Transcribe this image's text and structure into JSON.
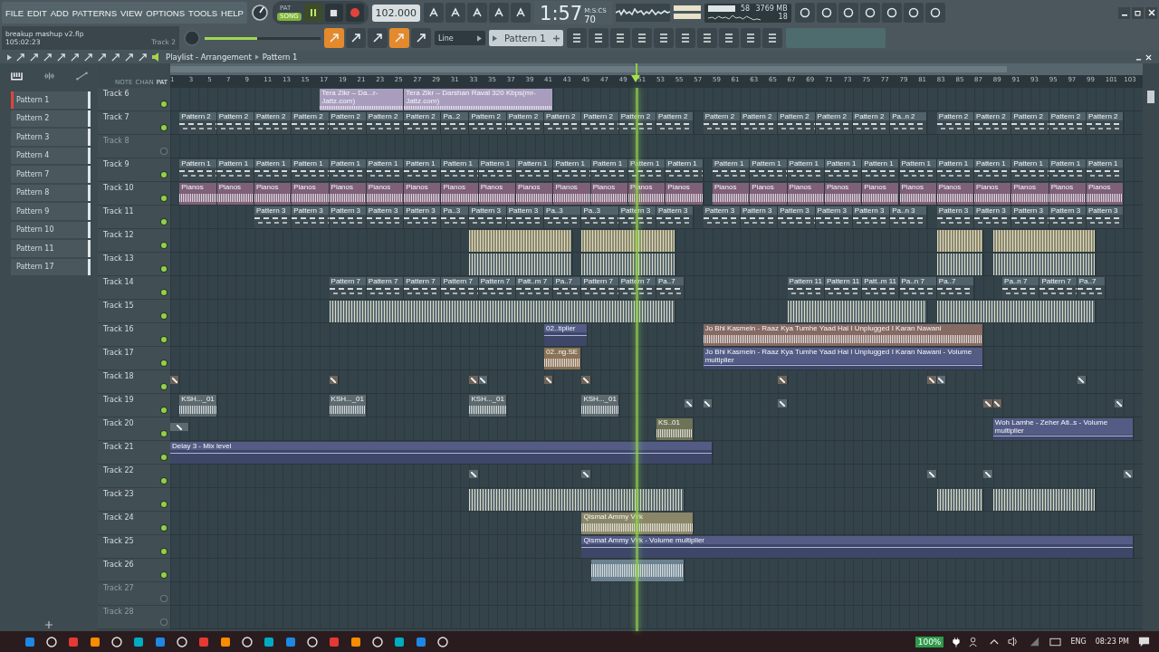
{
  "menu": [
    "FILE",
    "EDIT",
    "ADD",
    "PATTERNS",
    "VIEW",
    "OPTIONS",
    "TOOLS",
    "HELP"
  ],
  "transport": {
    "modes": [
      {
        "label": "PAT",
        "selected": false
      },
      {
        "label": "SONG",
        "selected": true
      }
    ],
    "playing": true,
    "tempo": "102.000",
    "time": "1:57",
    "time_sub": "70",
    "time_unit": "M:S:CS"
  },
  "monitor": {
    "cpu": "58",
    "memory": "3769 MB",
    "polyphony": "18"
  },
  "project": {
    "file": "breakup mashup v2.flp",
    "position": "105:02:23",
    "hint": "Track 2"
  },
  "master_volume": {
    "level": 0.45
  },
  "snap": "Line",
  "current_pattern": "Pattern 1",
  "playlist": {
    "title": "Playlist - Arrangement",
    "crumb": "Pattern 1",
    "picker_tabs": [
      {
        "label": "NOTE",
        "selected": false
      },
      {
        "label": "CHAN",
        "selected": false
      },
      {
        "label": "PAT",
        "selected": true
      }
    ],
    "patterns": [
      {
        "name": "Pattern 1",
        "selected": true
      },
      {
        "name": "Pattern 2",
        "selected": false
      },
      {
        "name": "Pattern 3",
        "selected": false
      },
      {
        "name": "Pattern 4",
        "selected": false
      },
      {
        "name": "Pattern 7",
        "selected": false
      },
      {
        "name": "Pattern 8",
        "selected": false
      },
      {
        "name": "Pattern 9",
        "selected": false
      },
      {
        "name": "Pattern 10",
        "selected": false
      },
      {
        "name": "Pattern 11",
        "selected": false
      },
      {
        "name": "Pattern 17",
        "selected": false
      }
    ],
    "ruler": [
      "1",
      "3",
      "5",
      "7",
      "9",
      "11",
      "13",
      "15",
      "17",
      "19",
      "21",
      "23",
      "25",
      "27",
      "29",
      "31",
      "33",
      "35",
      "37",
      "39",
      "41",
      "43",
      "45",
      "47",
      "49",
      "51",
      "53",
      "55",
      "57",
      "59",
      "61",
      "63",
      "65",
      "67",
      "69",
      "71",
      "73",
      "75",
      "77",
      "79",
      "81",
      "83",
      "85",
      "87",
      "89",
      "91",
      "93",
      "95",
      "97",
      "99",
      "101",
      "103"
    ],
    "tracks": [
      {
        "name": "Track 6",
        "muted": false,
        "clips": [
          {
            "kind": "audio",
            "label": "Tera Zikr – Da...r-Jattz.com)",
            "color": "#a99dbd"
          },
          {
            "kind": "audio",
            "label": "Tera Zikr – Darshan Raval 320 Kbps(mr-Jattz.com)",
            "color": "#a99dbd"
          }
        ]
      },
      {
        "name": "Track 7",
        "muted": false,
        "clips": [
          {
            "kind": "pattern",
            "label": "Pattern 2",
            "color": "#52626a"
          },
          {
            "kind": "pattern",
            "label": "Pattern 2",
            "color": "#52626a"
          },
          {
            "kind": "pattern",
            "label": "Pattern 2",
            "color": "#52626a"
          },
          {
            "kind": "pattern",
            "label": "Pattern 2",
            "color": "#52626a"
          },
          {
            "kind": "pattern",
            "label": "Pattern 2",
            "color": "#52626a"
          },
          {
            "kind": "pattern",
            "label": "Pattern 2",
            "color": "#52626a"
          },
          {
            "kind": "pattern",
            "label": "Pattern 2",
            "color": "#52626a"
          },
          {
            "kind": "pattern",
            "label": "Pa..2",
            "color": "#52626a"
          },
          {
            "kind": "pattern",
            "label": "Pattern 2",
            "color": "#52626a"
          },
          {
            "kind": "pattern",
            "label": "Pattern 2",
            "color": "#52626a"
          },
          {
            "kind": "pattern",
            "label": "Pattern 2",
            "color": "#52626a"
          },
          {
            "kind": "pattern",
            "label": "Pattern 2",
            "color": "#52626a"
          },
          {
            "kind": "pattern",
            "label": "Pattern 2",
            "color": "#52626a"
          },
          {
            "kind": "pattern",
            "label": "Pattern 2",
            "color": "#52626a"
          },
          {
            "kind": "pattern",
            "label": "Pattern 2",
            "color": "#52626a"
          },
          {
            "kind": "pattern",
            "label": "Pattern 2",
            "color": "#52626a"
          },
          {
            "kind": "pattern",
            "label": "Pattern 2",
            "color": "#52626a"
          },
          {
            "kind": "pattern",
            "label": "Pattern 2",
            "color": "#52626a"
          },
          {
            "kind": "pattern",
            "label": "Pattern 2",
            "color": "#52626a"
          },
          {
            "kind": "pattern",
            "label": "Pa..n 2",
            "color": "#52626a"
          },
          {
            "kind": "pattern",
            "label": "Pattern 2",
            "color": "#52626a"
          },
          {
            "kind": "pattern",
            "label": "Pattern 2",
            "color": "#52626a"
          },
          {
            "kind": "pattern",
            "label": "Pattern 2",
            "color": "#52626a"
          },
          {
            "kind": "pattern",
            "label": "Pattern 2",
            "color": "#52626a"
          },
          {
            "kind": "pattern",
            "label": "Pattern 2",
            "color": "#52626a"
          }
        ]
      },
      {
        "name": "Track 8",
        "muted": true
      },
      {
        "name": "Track 9",
        "muted": false,
        "clips": [
          {
            "kind": "pattern",
            "label": "Pattern 1",
            "color": "#52626a"
          },
          {
            "kind": "pattern",
            "label": "Pattern 1",
            "color": "#52626a"
          },
          {
            "kind": "pattern",
            "label": "Pattern 1",
            "color": "#52626a"
          },
          {
            "kind": "pattern",
            "label": "Pattern 1",
            "color": "#52626a"
          },
          {
            "kind": "pattern",
            "label": "Pattern 1",
            "color": "#52626a"
          },
          {
            "kind": "pattern",
            "label": "Pattern 1",
            "color": "#52626a"
          },
          {
            "kind": "pattern",
            "label": "Pattern 1",
            "color": "#52626a"
          },
          {
            "kind": "pattern",
            "label": "Pattern 1",
            "color": "#52626a"
          },
          {
            "kind": "pattern",
            "label": "Pattern 1",
            "color": "#52626a"
          },
          {
            "kind": "pattern",
            "label": "Pattern 1",
            "color": "#52626a"
          },
          {
            "kind": "pattern",
            "label": "Pattern 1",
            "color": "#52626a"
          },
          {
            "kind": "pattern",
            "label": "Pattern 1",
            "color": "#52626a"
          },
          {
            "kind": "pattern",
            "label": "Pattern 1",
            "color": "#52626a"
          },
          {
            "kind": "pattern",
            "label": "Pattern 1",
            "color": "#52626a"
          },
          {
            "kind": "pattern",
            "label": "Pattern 1",
            "color": "#52626a"
          },
          {
            "kind": "pattern",
            "label": "Pattern 1",
            "color": "#52626a"
          },
          {
            "kind": "pattern",
            "label": "Pattern 1",
            "color": "#52626a"
          },
          {
            "kind": "pattern",
            "label": "Pattern 1",
            "color": "#52626a"
          },
          {
            "kind": "pattern",
            "label": "Pattern 1",
            "color": "#52626a"
          },
          {
            "kind": "pattern",
            "label": "Pattern 1",
            "color": "#52626a"
          },
          {
            "kind": "pattern",
            "label": "Pattern 1",
            "color": "#52626a"
          },
          {
            "kind": "pattern",
            "label": "Pattern 1",
            "color": "#52626a"
          },
          {
            "kind": "pattern",
            "label": "Pattern 1",
            "color": "#52626a"
          },
          {
            "kind": "pattern",
            "label": "Pattern 1",
            "color": "#52626a"
          },
          {
            "kind": "pattern",
            "label": "Pattern 1",
            "color": "#52626a"
          }
        ]
      },
      {
        "name": "Track 10",
        "muted": false,
        "clips": [
          {
            "kind": "audio",
            "label": "Pianos",
            "color": "#7e6079"
          },
          {
            "kind": "audio",
            "label": "Pianos",
            "color": "#7e6079"
          },
          {
            "kind": "audio",
            "label": "Pianos",
            "color": "#7e6079"
          },
          {
            "kind": "audio",
            "label": "Pianos",
            "color": "#7e6079"
          },
          {
            "kind": "audio",
            "label": "Pianos",
            "color": "#7e6079"
          },
          {
            "kind": "audio",
            "label": "Pianos",
            "color": "#7e6079"
          },
          {
            "kind": "audio",
            "label": "Pianos",
            "color": "#7e6079"
          },
          {
            "kind": "audio",
            "label": "Pianos",
            "color": "#7e6079"
          },
          {
            "kind": "audio",
            "label": "Pianos",
            "color": "#7e6079"
          },
          {
            "kind": "audio",
            "label": "Pianos",
            "color": "#7e6079"
          },
          {
            "kind": "audio",
            "label": "Pianos",
            "color": "#7e6079"
          },
          {
            "kind": "audio",
            "label": "Pianos",
            "color": "#7e6079"
          },
          {
            "kind": "audio",
            "label": "Pianos",
            "color": "#7e6079"
          },
          {
            "kind": "audio",
            "label": "Pianos",
            "color": "#7e6079"
          },
          {
            "kind": "audio",
            "label": "Pianos",
            "color": "#7e6079"
          },
          {
            "kind": "audio",
            "label": "Pianos",
            "color": "#7e6079"
          },
          {
            "kind": "audio",
            "label": "Pianos",
            "color": "#7e6079"
          },
          {
            "kind": "audio",
            "label": "Pianos",
            "color": "#7e6079"
          },
          {
            "kind": "audio",
            "label": "Pianos",
            "color": "#7e6079"
          },
          {
            "kind": "audio",
            "label": "Pianos",
            "color": "#7e6079"
          },
          {
            "kind": "audio",
            "label": "Pianos",
            "color": "#7e6079"
          },
          {
            "kind": "audio",
            "label": "Pianos",
            "color": "#7e6079"
          },
          {
            "kind": "audio",
            "label": "Pianos",
            "color": "#7e6079"
          },
          {
            "kind": "audio",
            "label": "Pianos",
            "color": "#7e6079"
          },
          {
            "kind": "audio",
            "label": "Pianos",
            "color": "#7e6079"
          }
        ]
      },
      {
        "name": "Track 11",
        "muted": false,
        "clips": [
          {
            "kind": "pattern",
            "label": "Pattern 3",
            "color": "#52626a"
          },
          {
            "kind": "pattern",
            "label": "Pattern 3",
            "color": "#52626a"
          },
          {
            "kind": "pattern",
            "label": "Pattern 3",
            "color": "#52626a"
          },
          {
            "kind": "pattern",
            "label": "Pattern 3",
            "color": "#52626a"
          },
          {
            "kind": "pattern",
            "label": "Pattern 3",
            "color": "#52626a"
          },
          {
            "kind": "pattern",
            "label": "Pa..3",
            "color": "#52626a"
          },
          {
            "kind": "pattern",
            "label": "Pattern 3",
            "color": "#52626a"
          },
          {
            "kind": "pattern",
            "label": "Pattern 3",
            "color": "#52626a"
          },
          {
            "kind": "pattern",
            "label": "Pa..3",
            "color": "#52626a"
          },
          {
            "kind": "pattern",
            "label": "Pa..3",
            "color": "#52626a"
          },
          {
            "kind": "pattern",
            "label": "Pattern 3",
            "color": "#52626a"
          },
          {
            "kind": "pattern",
            "label": "Pattern 3",
            "color": "#52626a"
          },
          {
            "kind": "pattern",
            "label": "Pattern 3",
            "color": "#52626a"
          },
          {
            "kind": "pattern",
            "label": "Pattern 3",
            "color": "#52626a"
          },
          {
            "kind": "pattern",
            "label": "Pattern 3",
            "color": "#52626a"
          },
          {
            "kind": "pattern",
            "label": "Pattern 3",
            "color": "#52626a"
          },
          {
            "kind": "pattern",
            "label": "Pattern 3",
            "color": "#52626a"
          },
          {
            "kind": "pattern",
            "label": "Pa..n 3",
            "color": "#52626a"
          },
          {
            "kind": "pattern",
            "label": "Pattern 3",
            "color": "#52626a"
          },
          {
            "kind": "pattern",
            "label": "Pattern 3",
            "color": "#52626a"
          },
          {
            "kind": "pattern",
            "label": "Pattern 3",
            "color": "#52626a"
          },
          {
            "kind": "pattern",
            "label": "Pattern 3",
            "color": "#52626a"
          },
          {
            "kind": "pattern",
            "label": "Pattern 3",
            "color": "#52626a"
          }
        ]
      },
      {
        "name": "Track 12",
        "muted": false,
        "clips": [
          {
            "kind": "notes",
            "color": "#8f8a6c"
          },
          {
            "kind": "notes",
            "color": "#8f8a6c"
          },
          {
            "kind": "notes",
            "color": "#8f8a6c"
          },
          {
            "kind": "notes",
            "color": "#8f8a6c"
          }
        ]
      },
      {
        "name": "Track 13",
        "muted": false,
        "clips": [
          {
            "kind": "notes",
            "color": "#5b6b72"
          },
          {
            "kind": "notes",
            "color": "#5b6b72"
          },
          {
            "kind": "notes",
            "color": "#5b6b72"
          },
          {
            "kind": "notes",
            "color": "#5b6b72"
          }
        ]
      },
      {
        "name": "Track 14",
        "muted": false,
        "clips": [
          {
            "kind": "pattern",
            "label": "Pattern 7",
            "color": "#52626a"
          },
          {
            "kind": "pattern",
            "label": "Pattern 7",
            "color": "#52626a"
          },
          {
            "kind": "pattern",
            "label": "Pattern 7",
            "color": "#52626a"
          },
          {
            "kind": "pattern",
            "label": "Pattern 7",
            "color": "#52626a"
          },
          {
            "kind": "pattern",
            "label": "Pattern 7",
            "color": "#52626a"
          },
          {
            "kind": "pattern",
            "label": "Patt..m 7",
            "color": "#52626a"
          },
          {
            "kind": "pattern",
            "label": "Pa..7",
            "color": "#52626a"
          },
          {
            "kind": "pattern",
            "label": "Pattern 7",
            "color": "#52626a"
          },
          {
            "kind": "pattern",
            "label": "Pattern 7",
            "color": "#52626a"
          },
          {
            "kind": "pattern",
            "label": "Pa..7",
            "color": "#52626a"
          },
          {
            "kind": "pattern",
            "label": "Pattern 11",
            "color": "#52626a"
          },
          {
            "kind": "pattern",
            "label": "Pattern 11",
            "color": "#52626a"
          },
          {
            "kind": "pattern",
            "label": "Patt..m 11",
            "color": "#52626a"
          },
          {
            "kind": "pattern",
            "label": "Pa..n 7",
            "color": "#52626a"
          },
          {
            "kind": "pattern",
            "label": "Pa..7",
            "color": "#52626a"
          },
          {
            "kind": "pattern",
            "label": "Pa..n 7",
            "color": "#52626a"
          },
          {
            "kind": "pattern",
            "label": "Pattern 7",
            "color": "#52626a"
          },
          {
            "kind": "pattern",
            "label": "Pa..7",
            "color": "#52626a"
          }
        ]
      },
      {
        "name": "Track 15",
        "muted": false,
        "clips": [
          {
            "kind": "notes",
            "color": "#5b6b72"
          },
          {
            "kind": "notes",
            "color": "#5b6b72"
          },
          {
            "kind": "notes",
            "color": "#5b6b72"
          }
        ]
      },
      {
        "name": "Track 16",
        "muted": false,
        "clips": [
          {
            "kind": "automation",
            "label": "02..tiplier",
            "color": "#545c86"
          },
          {
            "kind": "audio",
            "label": "Jo Bhi Kasmein - Raaz  Kya Tumhe Yaad Hai I Unplugged I Karan Nawani",
            "color": "#866a64"
          }
        ]
      },
      {
        "name": "Track 17",
        "muted": false,
        "clips": [
          {
            "kind": "audio",
            "label": "02..ng.SE",
            "color": "#8a7256"
          },
          {
            "kind": "automation",
            "label": "Jo Bhi Kasmein - Raaz  Kya Tumhe Yaad Hai I Unplugged I Karan Nawani - Volume multiplier",
            "color": "#545c86"
          }
        ]
      },
      {
        "name": "Track 18",
        "muted": false,
        "clips": [
          {
            "kind": "marker",
            "color": "#6f6358"
          },
          {
            "kind": "marker",
            "color": "#6f6358"
          },
          {
            "kind": "marker",
            "color": "#6f6358"
          },
          {
            "kind": "marker",
            "color": "#5d6b70"
          },
          {
            "kind": "marker",
            "color": "#6f6358"
          },
          {
            "kind": "marker",
            "color": "#6f6358"
          },
          {
            "kind": "marker",
            "color": "#6f6358"
          },
          {
            "kind": "marker",
            "color": "#6f6358"
          },
          {
            "kind": "marker",
            "color": "#5d6b70"
          },
          {
            "kind": "marker",
            "color": "#5d6b70"
          }
        ]
      },
      {
        "name": "Track 19",
        "muted": false,
        "clips": [
          {
            "kind": "audio",
            "label": "KSH..._01",
            "color": "#5d6b70"
          },
          {
            "kind": "audio",
            "label": "KSH..._01",
            "color": "#5d6b70"
          },
          {
            "kind": "audio",
            "label": "KSH..._01",
            "color": "#5d6b70"
          },
          {
            "kind": "audio",
            "label": "KSH..._01",
            "color": "#5d6b70"
          },
          {
            "kind": "marker",
            "color": "#5d6b70"
          },
          {
            "kind": "marker",
            "color": "#5d6b70"
          },
          {
            "kind": "marker",
            "color": "#5d6b70"
          },
          {
            "kind": "marker",
            "color": "#6f6358"
          },
          {
            "kind": "marker",
            "color": "#6f6358"
          },
          {
            "kind": "marker",
            "color": "#5d6b70"
          }
        ]
      },
      {
        "name": "Track 20",
        "muted": false,
        "clips": [
          {
            "kind": "marker",
            "color": "#5d6b70"
          },
          {
            "kind": "audio",
            "label": "KS..01",
            "color": "#6e7358"
          },
          {
            "kind": "automation",
            "label": "Woh Lamhe - Zeher Ati..s - Volume multiplier",
            "color": "#545c86"
          }
        ]
      },
      {
        "name": "Track 21",
        "muted": false,
        "clips": [
          {
            "kind": "automation",
            "label": "Delay 3 - Mix level",
            "color": "#545c86"
          }
        ]
      },
      {
        "name": "Track 22",
        "muted": false,
        "clips": [
          {
            "kind": "marker",
            "color": "#5d6b70"
          },
          {
            "kind": "marker",
            "color": "#5d6b70"
          },
          {
            "kind": "marker",
            "color": "#5d6b70"
          },
          {
            "kind": "marker",
            "color": "#5d6b70"
          },
          {
            "kind": "marker",
            "color": "#5d6b70"
          }
        ]
      },
      {
        "name": "Track 23",
        "muted": false,
        "clips": [
          {
            "kind": "notes",
            "color": "#5b6b72"
          },
          {
            "kind": "notes",
            "color": "#5b6b72"
          },
          {
            "kind": "notes",
            "color": "#5b6b72"
          }
        ]
      },
      {
        "name": "Track 24",
        "muted": false,
        "clips": [
          {
            "kind": "audio",
            "label": "Qismat Ammy Virk",
            "color": "#8a8668"
          }
        ]
      },
      {
        "name": "Track 25",
        "muted": false,
        "clips": [
          {
            "kind": "automation",
            "label": "Qismat Ammy Virk - Volume multiplier",
            "color": "#545c86"
          }
        ]
      },
      {
        "name": "Track 26",
        "muted": false,
        "clips": [
          {
            "kind": "audio",
            "color": "#6c8290"
          }
        ]
      },
      {
        "name": "Track 27",
        "muted": true
      },
      {
        "name": "Track 28",
        "muted": true
      }
    ]
  },
  "taskbar": {
    "battery": "100%",
    "language": "ENG",
    "clock": "08:23 PM"
  }
}
